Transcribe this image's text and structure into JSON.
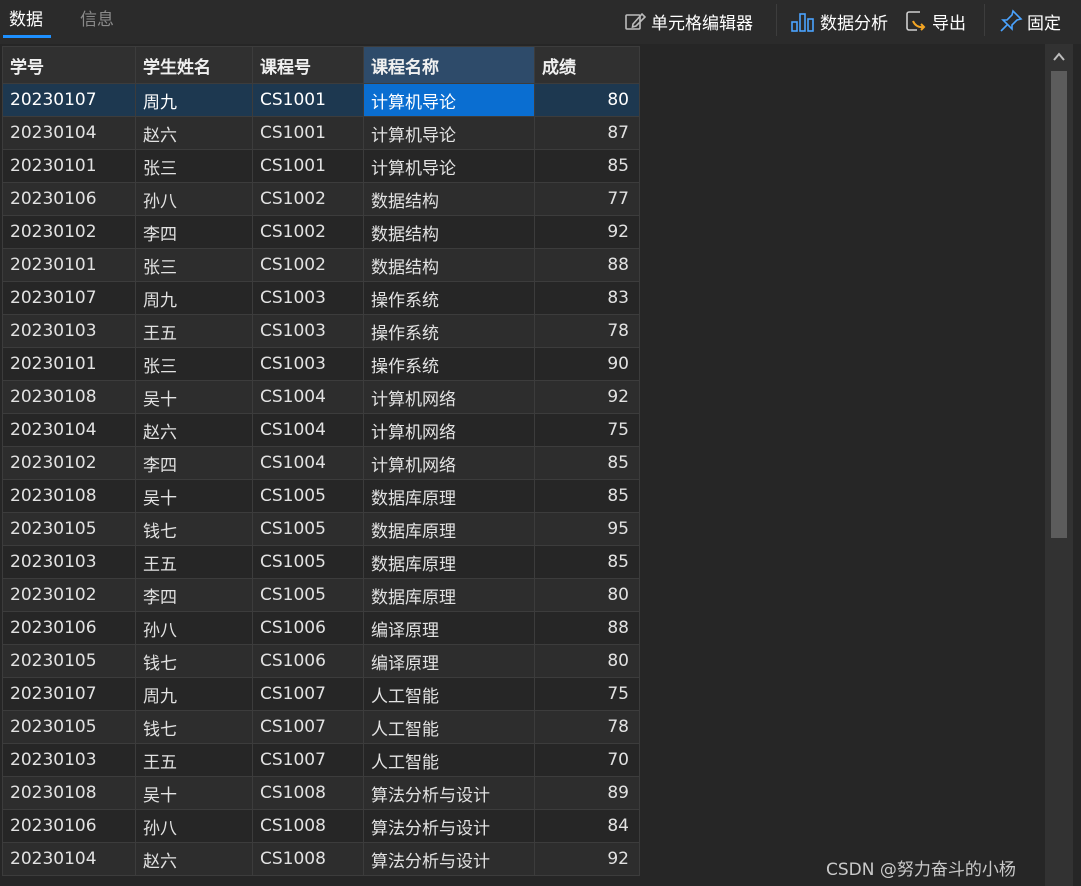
{
  "tabs": [
    {
      "label": "数据",
      "active": true
    },
    {
      "label": "信息",
      "active": false
    }
  ],
  "toolbar": {
    "cell_editor": "单元格编辑器",
    "data_analysis": "数据分析",
    "export": "导出",
    "pin": "固定"
  },
  "icons": {
    "cell_editor": "edit-pencil-icon",
    "data_analysis": "bar-chart-icon",
    "export": "export-arrow-icon",
    "pin": "pin-icon"
  },
  "colors": {
    "accent": "#1e90ff",
    "selected_cell": "#0a6ed1",
    "selected_row": "#1d3850",
    "selected_header": "#2e4b6a",
    "background": "#262626"
  },
  "table": {
    "columns": [
      "学号",
      "学生姓名",
      "课程号",
      "课程名称",
      "成绩"
    ],
    "selected_column": 3,
    "selected_row": 0,
    "rows": [
      [
        "20230107",
        "周九",
        "CS1001",
        "计算机导论",
        "80"
      ],
      [
        "20230104",
        "赵六",
        "CS1001",
        "计算机导论",
        "87"
      ],
      [
        "20230101",
        "张三",
        "CS1001",
        "计算机导论",
        "85"
      ],
      [
        "20230106",
        "孙八",
        "CS1002",
        "数据结构",
        "77"
      ],
      [
        "20230102",
        "李四",
        "CS1002",
        "数据结构",
        "92"
      ],
      [
        "20230101",
        "张三",
        "CS1002",
        "数据结构",
        "88"
      ],
      [
        "20230107",
        "周九",
        "CS1003",
        "操作系统",
        "83"
      ],
      [
        "20230103",
        "王五",
        "CS1003",
        "操作系统",
        "78"
      ],
      [
        "20230101",
        "张三",
        "CS1003",
        "操作系统",
        "90"
      ],
      [
        "20230108",
        "吴十",
        "CS1004",
        "计算机网络",
        "92"
      ],
      [
        "20230104",
        "赵六",
        "CS1004",
        "计算机网络",
        "75"
      ],
      [
        "20230102",
        "李四",
        "CS1004",
        "计算机网络",
        "85"
      ],
      [
        "20230108",
        "吴十",
        "CS1005",
        "数据库原理",
        "85"
      ],
      [
        "20230105",
        "钱七",
        "CS1005",
        "数据库原理",
        "95"
      ],
      [
        "20230103",
        "王五",
        "CS1005",
        "数据库原理",
        "85"
      ],
      [
        "20230102",
        "李四",
        "CS1005",
        "数据库原理",
        "80"
      ],
      [
        "20230106",
        "孙八",
        "CS1006",
        "编译原理",
        "88"
      ],
      [
        "20230105",
        "钱七",
        "CS1006",
        "编译原理",
        "80"
      ],
      [
        "20230107",
        "周九",
        "CS1007",
        "人工智能",
        "75"
      ],
      [
        "20230105",
        "钱七",
        "CS1007",
        "人工智能",
        "78"
      ],
      [
        "20230103",
        "王五",
        "CS1007",
        "人工智能",
        "70"
      ],
      [
        "20230108",
        "吴十",
        "CS1008",
        "算法分析与设计",
        "89"
      ],
      [
        "20230106",
        "孙八",
        "CS1008",
        "算法分析与设计",
        "84"
      ],
      [
        "20230104",
        "赵六",
        "CS1008",
        "算法分析与设计",
        "92"
      ]
    ]
  },
  "watermark": "CSDN @努力奋斗的小杨"
}
